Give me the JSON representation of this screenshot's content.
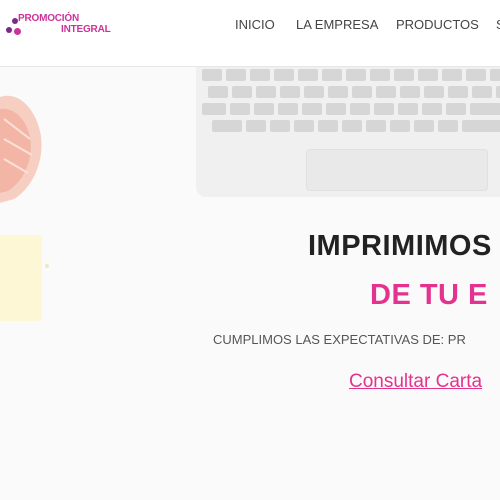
{
  "brand": {
    "line1": "PROMOCIÓN",
    "line2": "INTEGRAL",
    "colors": {
      "pink": "#cc3399",
      "purple": "#7a2a8c",
      "magenta": "#e4338f"
    }
  },
  "nav": {
    "items": [
      {
        "label": "INICIO"
      },
      {
        "label": "LA EMPRESA"
      },
      {
        "label": "PRODUCTOS"
      },
      {
        "label": "S"
      }
    ]
  },
  "hero": {
    "title_line1": "IMPRIMIMOS",
    "title_line2": "DE TU E",
    "subtitle": "CUMPLIMOS LAS EXPECTATIVAS DE: PR",
    "cta_label": "Consultar Carta",
    "accent_color": "#e4338f"
  }
}
